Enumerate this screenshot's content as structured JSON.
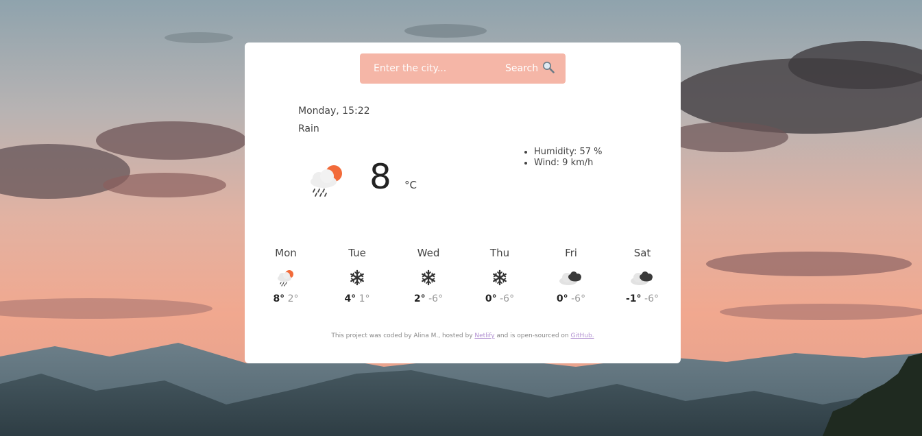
{
  "search": {
    "placeholder": "Enter the city...",
    "button_label": "Search",
    "icon": "magnifier-icon"
  },
  "current": {
    "datetime": "Monday, 15:22",
    "description": "Rain",
    "temperature": "8",
    "unit": "°C",
    "icon": "rain-sun-cloud-icon",
    "details": [
      "Humidity: 57 %",
      "Wind: 9 km/h"
    ]
  },
  "forecast": [
    {
      "day": "Mon",
      "max": "8°",
      "min": "2°",
      "icon": "rain-sun-cloud-icon"
    },
    {
      "day": "Tue",
      "max": "4°",
      "min": "1°",
      "icon": "snowflake-icon"
    },
    {
      "day": "Wed",
      "max": "2°",
      "min": "-6°",
      "icon": "snowflake-icon"
    },
    {
      "day": "Thu",
      "max": "0°",
      "min": "-6°",
      "icon": "snowflake-icon"
    },
    {
      "day": "Fri",
      "max": "0°",
      "min": "-6°",
      "icon": "dark-clouds-icon"
    },
    {
      "day": "Sat",
      "max": "-1°",
      "min": "-6°",
      "icon": "dark-clouds-icon"
    }
  ],
  "footer": {
    "text_1": "This project was coded by Alina M., hosted by ",
    "link_1": "Netlify",
    "text_2": " and is open-sourced on ",
    "link_2": "GitHub."
  },
  "colors": {
    "search_bg": "#f5b6a7",
    "sun": "#f26b3a",
    "link": "#b08fd0"
  }
}
